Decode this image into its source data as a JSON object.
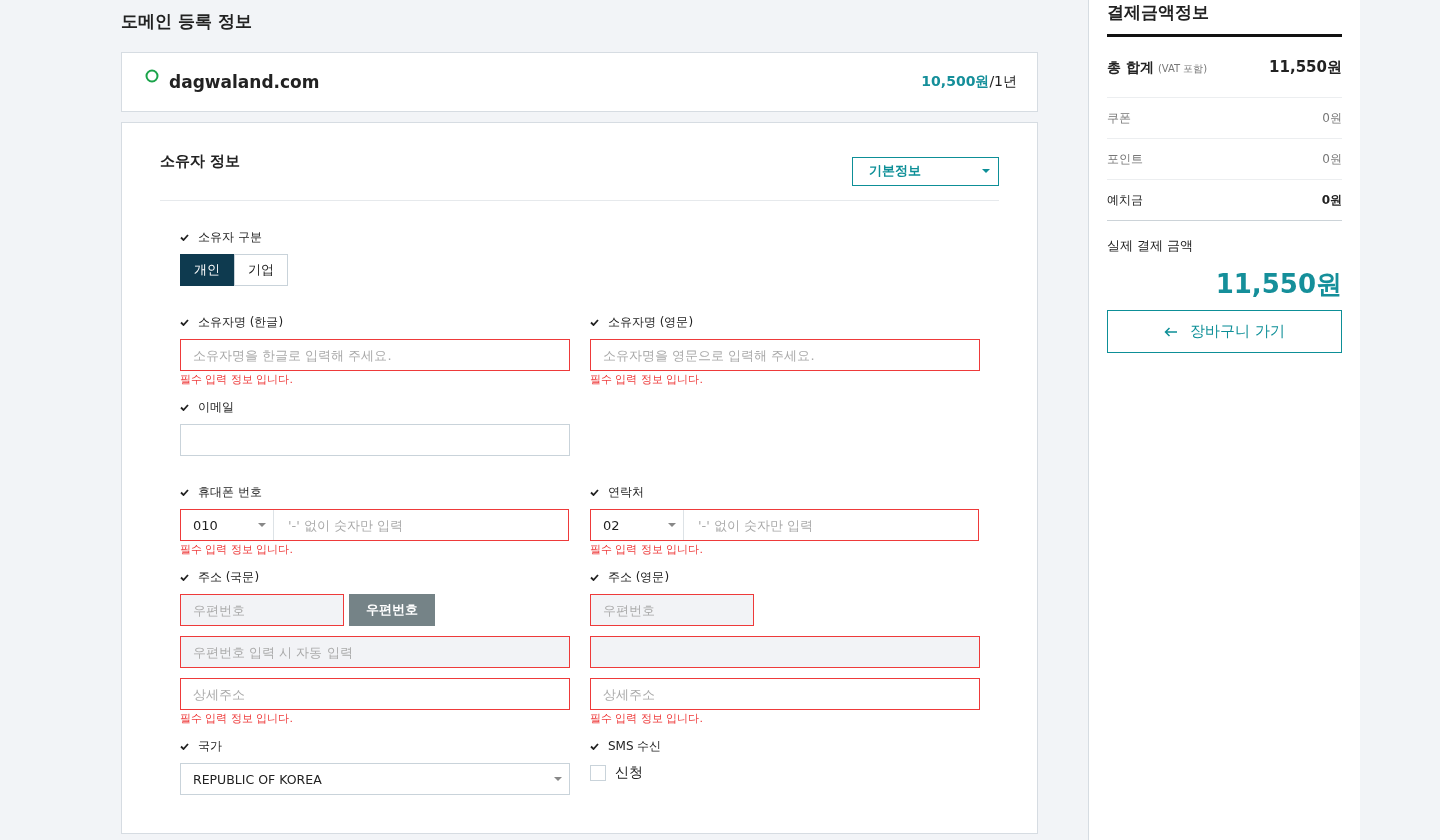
{
  "page_title": "도메인 등록 정보",
  "domain": {
    "name": "dagwaland.com",
    "price": "10,500원",
    "period": "/1년"
  },
  "owner": {
    "title": "소유자 정보",
    "preset": "기본정보",
    "type": {
      "label": "소유자 구분",
      "options": [
        {
          "label": "개인",
          "selected": true
        },
        {
          "label": "기업",
          "selected": false
        }
      ]
    },
    "rows": [
      [
        {
          "kind": "text",
          "label": "소유자명 (한글)",
          "placeholder": "소유자명을 한글로 입력해 주세요.",
          "invalid": true,
          "error": "필수 입력 정보 입니다."
        },
        {
          "kind": "text",
          "label": "소유자명 (영문)",
          "placeholder": "소유자명을 영문으로 입력해 주세요.",
          "invalid": true,
          "error": "필수 입력 정보 입니다."
        }
      ],
      [
        {
          "kind": "text",
          "label": "이메일",
          "invalid": false
        }
      ],
      [
        {
          "kind": "phone",
          "label": "휴대폰 번호",
          "prefix": "010",
          "placeholder": "'-' 없이 숫자만 입력",
          "invalid": true,
          "error": "필수 입력 정보 입니다."
        },
        {
          "kind": "phone",
          "label": "연락처",
          "prefix": "02",
          "placeholder": "'-' 없이 숫자만 입력",
          "invalid": true,
          "error": "필수 입력 정보 입니다."
        }
      ],
      [
        {
          "kind": "address",
          "label": "주소 (국문)",
          "zip_placeholder": "우편번호",
          "zip_button": "우편번호",
          "line1_placeholder": "우편번호 입력 시 자동 입력",
          "detail_placeholder": "상세주소",
          "invalid": true,
          "error": "필수 입력 정보 입니다."
        },
        {
          "kind": "address",
          "label": "주소 (영문)",
          "zip_placeholder": "우편번호",
          "detail_placeholder": "상세주소",
          "invalid": true,
          "error": "필수 입력 정보 입니다."
        }
      ],
      [
        {
          "kind": "select",
          "label": "국가",
          "value": "REPUBLIC OF KOREA"
        },
        {
          "kind": "checkbox",
          "label": "SMS 수신",
          "option": "신청",
          "checked": false
        }
      ]
    ]
  },
  "summary": {
    "title": "결제금액정보",
    "total": {
      "label": "총 합계",
      "note": "(VAT 포함)",
      "value": "11,550원"
    },
    "lines": [
      {
        "label": "쿠폰",
        "value": "0원",
        "kind": "muted"
      },
      {
        "label": "포인트",
        "value": "0원",
        "kind": "muted"
      },
      {
        "label": "예치금",
        "value": "0원",
        "kind": "strong"
      }
    ],
    "final_label": "실제 결제 금액",
    "final_value": "11,550원",
    "cart_button": "장바구니 가기"
  }
}
